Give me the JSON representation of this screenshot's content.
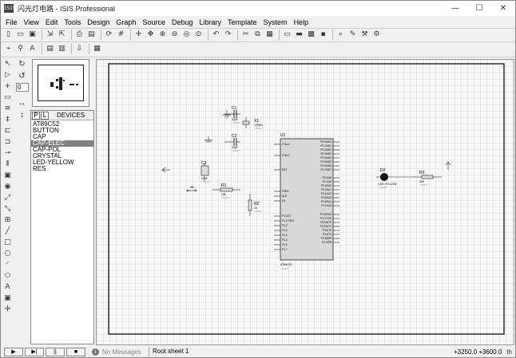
{
  "window": {
    "app_icon_text": "ISIS",
    "title": "闪光灯电路 - ISIS Professional",
    "minimize": "—",
    "maximize": "☐",
    "close": "✕"
  },
  "menu": [
    "File",
    "View",
    "Edit",
    "Tools",
    "Design",
    "Graph",
    "Source",
    "Debug",
    "Library",
    "Template",
    "System",
    "Help"
  ],
  "toolbar_icons": {
    "row1": [
      "new-file-icon",
      "open-folder-icon",
      "save-icon",
      "sep",
      "import-icon",
      "export-icon",
      "sep",
      "print-icon",
      "print-area-icon",
      "sep",
      "refresh-icon",
      "grid-icon",
      "sep",
      "origin-icon",
      "pan-icon",
      "zoom-in-icon",
      "zoom-out-icon",
      "zoom-all-icon",
      "zoom-area-icon",
      "sep",
      "undo-icon",
      "redo-icon",
      "sep",
      "cut-icon",
      "copy-icon",
      "paste-icon",
      "sep",
      "block-copy-icon",
      "block-move-icon",
      "block-rotate-icon",
      "block-delete-icon",
      "sep",
      "pick-device-icon",
      "make-device-icon",
      "packaging-tool-icon",
      "decompose-icon"
    ],
    "row2": [
      "wire-autorouter-icon",
      "search-tag-icon",
      "property-assign-icon",
      "sep",
      "new-sheet-icon",
      "remove-sheet-icon",
      "sep",
      "goto-child-icon",
      "sep",
      "bill-of-materials-icon"
    ]
  },
  "left_tools": [
    "selection-mode-icon",
    "component-mode-icon",
    "junction-dot-icon",
    "wire-label-icon",
    "text-script-icon",
    "bus-icon",
    "subcircuit-icon",
    "terminals-icon",
    "device-pins-icon",
    "graph-icon",
    "tape-recorder-icon",
    "generator-icon",
    "voltage-probe-icon",
    "current-probe-icon",
    "virtual-instruments-icon",
    "line-icon",
    "box-icon",
    "circle-icon",
    "arc-icon",
    "path-icon",
    "text-icon",
    "symbol-icon",
    "marker-icon"
  ],
  "orientation": {
    "rotate_cw": "↻",
    "rotate_ccw": "↺",
    "angle_value": "0",
    "flip_h": "↔",
    "flip_v": "↕"
  },
  "device_panel": {
    "tab_p": "P",
    "tab_l": "L",
    "title": "DEVICES",
    "items": [
      "AT89C52",
      "BUTTON",
      "CAP",
      "CAP-ELEC",
      "CAP-POL",
      "CRYSTAL",
      "LED-YELLOW",
      "RES"
    ],
    "selected_index": 3
  },
  "schematic": {
    "u1": {
      "ref": "U1",
      "part": "AT89C52",
      "text": "<TEXT>",
      "left_pins": [
        "XTAL1",
        "XTAL2",
        "RST",
        "PSEN",
        "ALE",
        "EA",
        "P1.0/T2",
        "P1.1/T2EX",
        "P1.2",
        "P1.3",
        "P1.4",
        "P1.5",
        "P1.6",
        "P1.7"
      ],
      "right_pins": [
        "P0.0/AD0",
        "P0.1/AD1",
        "P0.2/AD2",
        "P0.3/AD3",
        "P0.4/AD4",
        "P0.5/AD5",
        "P0.6/AD6",
        "P0.7/AD7",
        "P2.0/A8",
        "P2.1/A9",
        "P2.2/A10",
        "P2.3/A11",
        "P2.4/A12",
        "P2.5/A13",
        "P2.6/A14",
        "P2.7/A15",
        "P3.0/RXD",
        "P3.1/TXD",
        "P3.2/INT0",
        "P3.3/INT1",
        "P3.4/T0",
        "P3.5/T1",
        "P3.6/WR",
        "P3.7/RD"
      ]
    },
    "c1": {
      "ref": "C1",
      "value": "33pF",
      "text": "<TEXT>"
    },
    "c2": {
      "ref": "C2",
      "value": "33pF",
      "text": "<TEXT>"
    },
    "c3": {
      "ref": "C3",
      "value": "10uF",
      "text": "<TEXT>"
    },
    "x1": {
      "ref": "X1",
      "value": "12MHz",
      "text": "<TEXT>"
    },
    "r1": {
      "ref": "R1",
      "value": "10k",
      "text": "<TEXT>"
    },
    "r2": {
      "ref": "R2",
      "value": "1k",
      "text": "<TEXT>"
    },
    "r3": {
      "ref": "R3",
      "value": "330",
      "text": "<TEXT>"
    },
    "d2": {
      "ref": "D2",
      "value": "LED-YELLOW",
      "text": "<TEXT>"
    }
  },
  "status": {
    "play": "▶",
    "step": "▶|",
    "pause": "||",
    "stop": "■",
    "info_icon_text": "i",
    "messages": "No Messages",
    "sheet": "Root sheet 1",
    "coord_x": "+3250.0",
    "coord_y": "+3600.0",
    "unit": "th"
  }
}
